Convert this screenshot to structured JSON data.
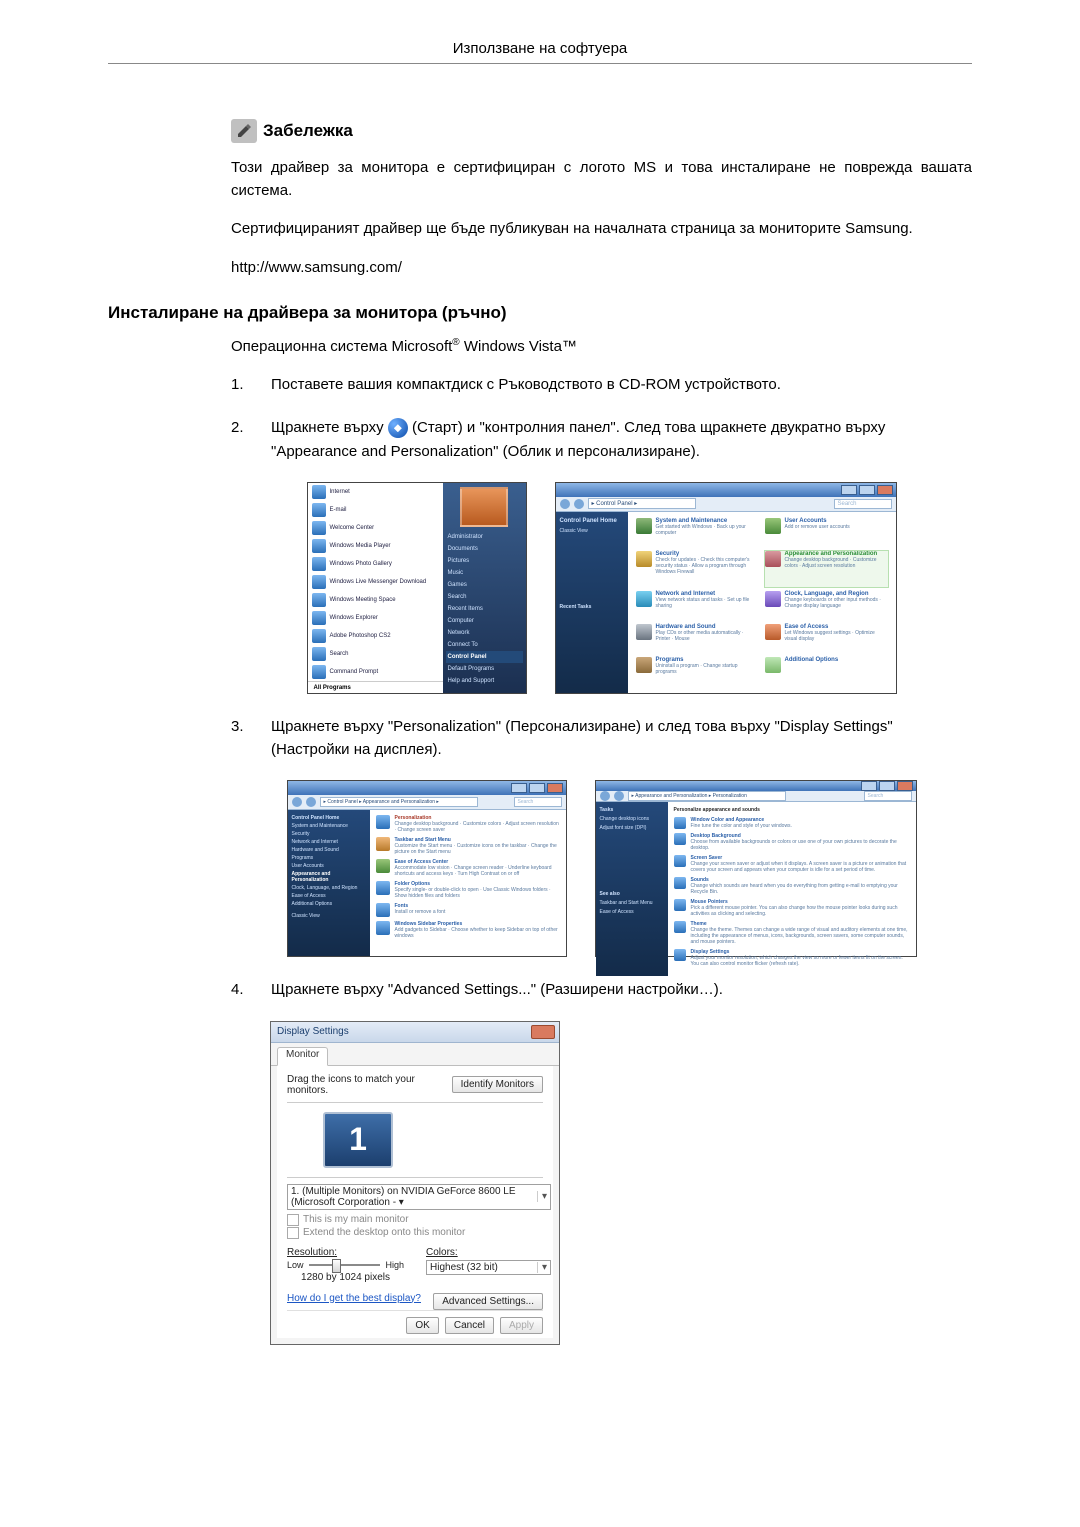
{
  "header": {
    "title": "Използване на софтуера"
  },
  "note": {
    "label": "Забележка",
    "p1": "Този драйвер за монитора е сертифициран с логото MS и това инсталиране не поврежда вашата система.",
    "p2": "Сертифицираният драйвер ще бъде публикуван на началната страница за мониторите Samsung.",
    "url": "http://www.samsung.com/"
  },
  "section": {
    "title": "Инсталиране на драйвера за монитора (ръчно)",
    "os_prefix": "Операционна система Microsoft",
    "os_suffix": " Windows Vista™"
  },
  "steps": {
    "s1_num": "1.",
    "s1": "Поставете вашия компактдиск с Ръководството в CD-ROM устройството.",
    "s2_num": "2.",
    "s2a": "Щракнете върху ",
    "s2b": "(Старт) и \"контролния панел\". След това щракнете двукратно върху \"Appearance and Personalization\" (Облик и персонализиране).",
    "s3_num": "3.",
    "s3": "Щракнете върху \"Personalization\" (Персонализиране) и след това върху \"Display Settings\" (Настройки на дисплея).",
    "s4_num": "4.",
    "s4": "Щракнете върху \"Advanced Settings...\" (Разширени настройки…)."
  },
  "startmenu": {
    "items": [
      "Internet",
      "E-mail",
      "Welcome Center",
      "Windows Media Player",
      "Windows Photo Gallery",
      "Windows Live Messenger Download",
      "Windows Meeting Space",
      "Windows Explorer",
      "Adobe Photoshop CS2",
      "Search",
      "Command Prompt"
    ],
    "all": "All Programs",
    "right": [
      "Administrator",
      "Documents",
      "Pictures",
      "Music",
      "Games",
      "Search",
      "Recent Items",
      "Computer",
      "Network",
      "Connect To",
      "Control Panel",
      "Default Programs",
      "Help and Support"
    ]
  },
  "cpanel": {
    "address": "▸ Control Panel ▸",
    "search": "Search",
    "side_hd": "Control Panel Home",
    "side_lk": "Classic View",
    "recent": "Recent Tasks",
    "categories": [
      {
        "t": "System and Maintenance",
        "s": "Get started with Windows · Back up your computer"
      },
      {
        "t": "User Accounts",
        "s": "Add or remove user accounts"
      },
      {
        "t": "Security",
        "s": "Check for updates · Check this computer's security status · Allow a program through Windows Firewall"
      },
      {
        "t": "Appearance and Personalization",
        "s": "Change desktop background · Customize colors · Adjust screen resolution"
      },
      {
        "t": "Network and Internet",
        "s": "View network status and tasks · Set up file sharing"
      },
      {
        "t": "Clock, Language, and Region",
        "s": "Change keyboards or other input methods · Change display language"
      },
      {
        "t": "Hardware and Sound",
        "s": "Play CDs or other media automatically · Printer · Mouse"
      },
      {
        "t": "Ease of Access",
        "s": "Let Windows suggest settings · Optimize visual display"
      },
      {
        "t": "Programs",
        "s": "Uninstall a program · Change startup programs"
      },
      {
        "t": "Additional Options",
        "s": ""
      }
    ]
  },
  "appear_panel": {
    "address": "▸ Control Panel ▸ Appearance and Personalization ▸",
    "side": [
      "Control Panel Home",
      "System and Maintenance",
      "Security",
      "Network and Internet",
      "Hardware and Sound",
      "Programs",
      "User Accounts",
      "Appearance and Personalization",
      "Clock, Language, and Region",
      "Ease of Access",
      "Additional Options",
      "Classic View"
    ],
    "items": [
      {
        "ttl": "Personalization",
        "sub": "Change desktop background · Customize colors · Adjust screen resolution · Change screen saver"
      },
      {
        "ttl": "Taskbar and Start Menu",
        "sub": "Customize the Start menu · Customize icons on the taskbar · Change the picture on the Start menu"
      },
      {
        "ttl": "Ease of Access Center",
        "sub": "Accommodate low vision · Change screen reader · Underline keyboard shortcuts and access keys · Turn High Contrast on or off"
      },
      {
        "ttl": "Folder Options",
        "sub": "Specify single- or double-click to open · Use Classic Windows folders · Show hidden files and folders"
      },
      {
        "ttl": "Fonts",
        "sub": "Install or remove a font"
      },
      {
        "ttl": "Windows Sidebar Properties",
        "sub": "Add gadgets to Sidebar · Choose whether to keep Sidebar on top of other windows"
      }
    ]
  },
  "personalization_panel": {
    "address": "▸ Appearance and Personalization ▸ Personalization",
    "title": "Personalize appearance and sounds",
    "side_hd": "Tasks",
    "side": [
      "Change desktop icons",
      "Adjust font size (DPI)"
    ],
    "seealso": "See also",
    "seealso_items": [
      "Taskbar and Start Menu",
      "Ease of Access"
    ],
    "items": [
      {
        "ttl": "Window Color and Appearance",
        "sub": "Fine tune the color and style of your windows."
      },
      {
        "ttl": "Desktop Background",
        "sub": "Choose from available backgrounds or colors or use one of your own pictures to decorate the desktop."
      },
      {
        "ttl": "Screen Saver",
        "sub": "Change your screen saver or adjust when it displays. A screen saver is a picture or animation that covers your screen and appears when your computer is idle for a set period of time."
      },
      {
        "ttl": "Sounds",
        "sub": "Change which sounds are heard when you do everything from getting e-mail to emptying your Recycle Bin."
      },
      {
        "ttl": "Mouse Pointers",
        "sub": "Pick a different mouse pointer. You can also change how the mouse pointer looks during such activities as clicking and selecting."
      },
      {
        "ttl": "Theme",
        "sub": "Change the theme. Themes can change a wide range of visual and auditory elements at one time, including the appearance of menus, icons, backgrounds, screen savers, some computer sounds, and mouse pointers."
      },
      {
        "ttl": "Display Settings",
        "sub": "Adjust your monitor resolution, which changes the view so more or fewer items fit on the screen. You can also control monitor flicker (refresh rate)."
      }
    ]
  },
  "display_dlg": {
    "title": "Display Settings",
    "tab": "Monitor",
    "drag": "Drag the icons to match your monitors.",
    "identify": "Identify Monitors",
    "mon_num": "1",
    "select": "1. (Multiple Monitors) on NVIDIA GeForce 8600 LE (Microsoft Corporation - ▾",
    "cb1": "This is my main monitor",
    "cb2": "Extend the desktop onto this monitor",
    "res_hd": "Resolution:",
    "low": "Low",
    "high": "High",
    "res_val": "1280 by 1024 pixels",
    "col_hd": "Colors:",
    "col_val": "Highest (32 bit)",
    "help": "How do I get the best display?",
    "adv": "Advanced Settings...",
    "ok": "OK",
    "cancel": "Cancel",
    "apply": "Apply"
  }
}
